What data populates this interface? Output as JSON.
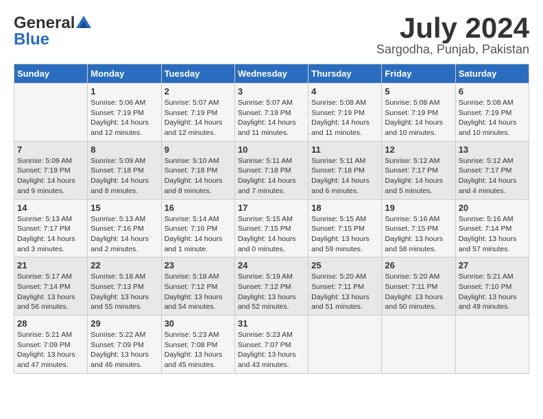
{
  "header": {
    "logo_line1": "General",
    "logo_line2": "Blue",
    "month": "July 2024",
    "location": "Sargodha, Punjab, Pakistan"
  },
  "weekdays": [
    "Sunday",
    "Monday",
    "Tuesday",
    "Wednesday",
    "Thursday",
    "Friday",
    "Saturday"
  ],
  "weeks": [
    [
      {
        "day": "",
        "info": ""
      },
      {
        "day": "1",
        "info": "Sunrise: 5:06 AM\nSunset: 7:19 PM\nDaylight: 14 hours\nand 12 minutes."
      },
      {
        "day": "2",
        "info": "Sunrise: 5:07 AM\nSunset: 7:19 PM\nDaylight: 14 hours\nand 12 minutes."
      },
      {
        "day": "3",
        "info": "Sunrise: 5:07 AM\nSunset: 7:19 PM\nDaylight: 14 hours\nand 11 minutes."
      },
      {
        "day": "4",
        "info": "Sunrise: 5:08 AM\nSunset: 7:19 PM\nDaylight: 14 hours\nand 11 minutes."
      },
      {
        "day": "5",
        "info": "Sunrise: 5:08 AM\nSunset: 7:19 PM\nDaylight: 14 hours\nand 10 minutes."
      },
      {
        "day": "6",
        "info": "Sunrise: 5:08 AM\nSunset: 7:19 PM\nDaylight: 14 hours\nand 10 minutes."
      }
    ],
    [
      {
        "day": "7",
        "info": "Sunrise: 5:09 AM\nSunset: 7:19 PM\nDaylight: 14 hours\nand 9 minutes."
      },
      {
        "day": "8",
        "info": "Sunrise: 5:09 AM\nSunset: 7:18 PM\nDaylight: 14 hours\nand 8 minutes."
      },
      {
        "day": "9",
        "info": "Sunrise: 5:10 AM\nSunset: 7:18 PM\nDaylight: 14 hours\nand 8 minutes."
      },
      {
        "day": "10",
        "info": "Sunrise: 5:11 AM\nSunset: 7:18 PM\nDaylight: 14 hours\nand 7 minutes."
      },
      {
        "day": "11",
        "info": "Sunrise: 5:11 AM\nSunset: 7:18 PM\nDaylight: 14 hours\nand 6 minutes."
      },
      {
        "day": "12",
        "info": "Sunrise: 5:12 AM\nSunset: 7:17 PM\nDaylight: 14 hours\nand 5 minutes."
      },
      {
        "day": "13",
        "info": "Sunrise: 5:12 AM\nSunset: 7:17 PM\nDaylight: 14 hours\nand 4 minutes."
      }
    ],
    [
      {
        "day": "14",
        "info": "Sunrise: 5:13 AM\nSunset: 7:17 PM\nDaylight: 14 hours\nand 3 minutes."
      },
      {
        "day": "15",
        "info": "Sunrise: 5:13 AM\nSunset: 7:16 PM\nDaylight: 14 hours\nand 2 minutes."
      },
      {
        "day": "16",
        "info": "Sunrise: 5:14 AM\nSunset: 7:16 PM\nDaylight: 14 hours\nand 1 minute."
      },
      {
        "day": "17",
        "info": "Sunrise: 5:15 AM\nSunset: 7:15 PM\nDaylight: 14 hours\nand 0 minutes."
      },
      {
        "day": "18",
        "info": "Sunrise: 5:15 AM\nSunset: 7:15 PM\nDaylight: 13 hours\nand 59 minutes."
      },
      {
        "day": "19",
        "info": "Sunrise: 5:16 AM\nSunset: 7:15 PM\nDaylight: 13 hours\nand 58 minutes."
      },
      {
        "day": "20",
        "info": "Sunrise: 5:16 AM\nSunset: 7:14 PM\nDaylight: 13 hours\nand 57 minutes."
      }
    ],
    [
      {
        "day": "21",
        "info": "Sunrise: 5:17 AM\nSunset: 7:14 PM\nDaylight: 13 hours\nand 56 minutes."
      },
      {
        "day": "22",
        "info": "Sunrise: 5:18 AM\nSunset: 7:13 PM\nDaylight: 13 hours\nand 55 minutes."
      },
      {
        "day": "23",
        "info": "Sunrise: 5:18 AM\nSunset: 7:12 PM\nDaylight: 13 hours\nand 54 minutes."
      },
      {
        "day": "24",
        "info": "Sunrise: 5:19 AM\nSunset: 7:12 PM\nDaylight: 13 hours\nand 52 minutes."
      },
      {
        "day": "25",
        "info": "Sunrise: 5:20 AM\nSunset: 7:11 PM\nDaylight: 13 hours\nand 51 minutes."
      },
      {
        "day": "26",
        "info": "Sunrise: 5:20 AM\nSunset: 7:11 PM\nDaylight: 13 hours\nand 50 minutes."
      },
      {
        "day": "27",
        "info": "Sunrise: 5:21 AM\nSunset: 7:10 PM\nDaylight: 13 hours\nand 49 minutes."
      }
    ],
    [
      {
        "day": "28",
        "info": "Sunrise: 5:21 AM\nSunset: 7:09 PM\nDaylight: 13 hours\nand 47 minutes."
      },
      {
        "day": "29",
        "info": "Sunrise: 5:22 AM\nSunset: 7:09 PM\nDaylight: 13 hours\nand 46 minutes."
      },
      {
        "day": "30",
        "info": "Sunrise: 5:23 AM\nSunset: 7:08 PM\nDaylight: 13 hours\nand 45 minutes."
      },
      {
        "day": "31",
        "info": "Sunrise: 5:23 AM\nSunset: 7:07 PM\nDaylight: 13 hours\nand 43 minutes."
      },
      {
        "day": "",
        "info": ""
      },
      {
        "day": "",
        "info": ""
      },
      {
        "day": "",
        "info": ""
      }
    ]
  ]
}
